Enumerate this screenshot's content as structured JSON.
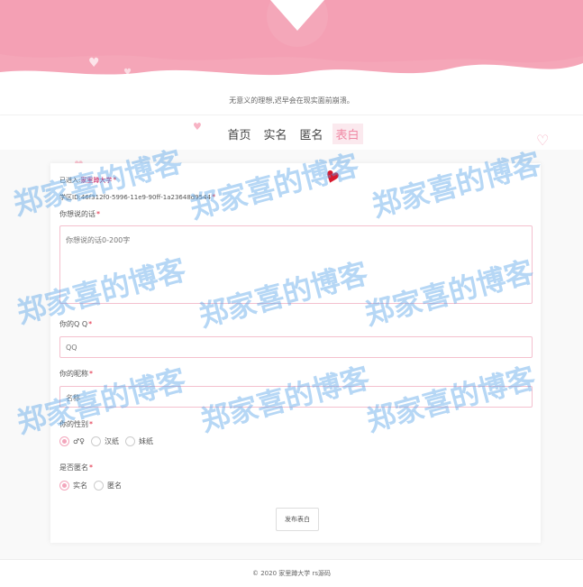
{
  "motto": "无意义的理想,迟早会在现实面前崩溃。",
  "nav": {
    "items": [
      {
        "label": "首页"
      },
      {
        "label": "实名"
      },
      {
        "label": "匿名"
      },
      {
        "label": "表白",
        "active": true
      }
    ]
  },
  "form": {
    "entered_prefix": "已进入:",
    "school_name": "家里蹲大学",
    "school_id_line": "学区ID:46f312f0-5996-11e9-90ff-1a23648d9544",
    "message_label": "你想说的话",
    "message_placeholder": "你想说的话0-200字",
    "qq_label": "你的Q Q",
    "qq_placeholder": "QQ",
    "nickname_label": "你的昵称",
    "nickname_placeholder": "名称",
    "gender_label": "你的性别",
    "gender_options": [
      {
        "label": "♂♀",
        "checked": true
      },
      {
        "label": "汉纸",
        "checked": false
      },
      {
        "label": "妹纸",
        "checked": false
      }
    ],
    "anon_label": "是否匿名",
    "anon_options": [
      {
        "label": "实名",
        "checked": true
      },
      {
        "label": "匿名",
        "checked": false
      }
    ],
    "submit_label": "发布表白"
  },
  "footer": {
    "text": "© 2020 家里蹲大学   rs源码"
  },
  "watermark": {
    "text": "郑家喜的博客"
  },
  "colors": {
    "accent": "#f08aa5",
    "hero_pink": "#f5a6b8",
    "required": "#e0203a",
    "watermark": "#50a0e6"
  }
}
